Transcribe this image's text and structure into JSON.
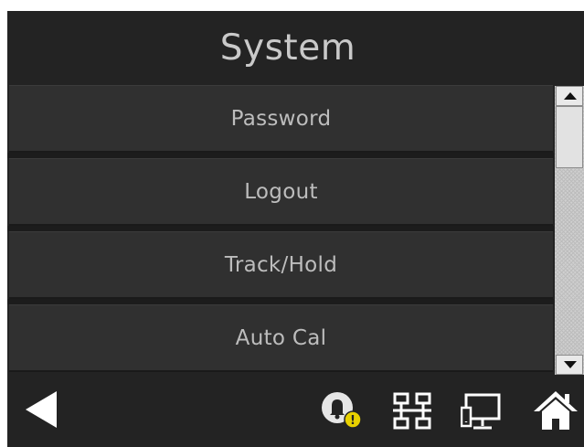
{
  "header": {
    "title": "System"
  },
  "menu": {
    "items": [
      {
        "label": "Password"
      },
      {
        "label": "Logout"
      },
      {
        "label": "Track/Hold"
      },
      {
        "label": "Auto Cal"
      }
    ]
  },
  "scrollbar": {
    "up_icon": "triangle-up-icon",
    "down_icon": "triangle-down-icon"
  },
  "bottom_bar": {
    "icons": [
      "back-arrow-icon",
      "alarm-bell-icon",
      "network-icon",
      "display-icon",
      "home-icon"
    ],
    "alarm_badge": "!"
  },
  "colors": {
    "background": "#232323",
    "button": "#303030",
    "text": "#bdbdbd",
    "title": "#c9c9c9",
    "badge": "#e8d100",
    "icon": "#ffffff"
  }
}
